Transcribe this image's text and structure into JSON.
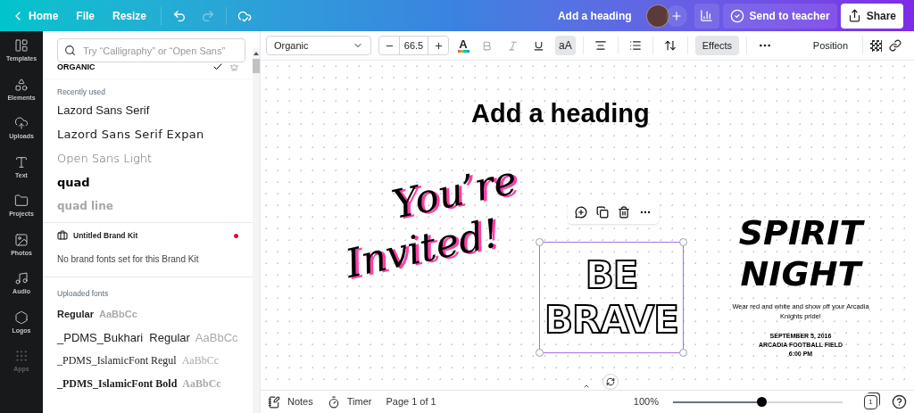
{
  "topbar": {
    "nav": [
      "Home",
      "File",
      "Resize"
    ],
    "title": "Add a heading",
    "send": "Send to teacher",
    "share": "Share"
  },
  "rail": [
    {
      "label": "Templates",
      "selected": false
    },
    {
      "label": "Elements",
      "selected": false
    },
    {
      "label": "Uploads",
      "selected": false
    },
    {
      "label": "Text",
      "selected": false
    },
    {
      "label": "Projects",
      "selected": false
    },
    {
      "label": "Photos",
      "selected": false
    },
    {
      "label": "Audio",
      "selected": false
    },
    {
      "label": "Logos",
      "selected": false
    },
    {
      "label": "Apps",
      "selected": false
    }
  ],
  "font_panel": {
    "placeholder": "Try “Calligraphy” or “Open Sans”",
    "current": {
      "name": "ORGANIC",
      "checked": true
    },
    "recent": {
      "heading": "Recently used",
      "fonts": [
        "Lazord Sans Serif",
        "Lazord Sans Serif Expan",
        "Open Sans Light",
        "quad",
        "quad line"
      ]
    },
    "brand_kit": {
      "title": "Untitled Brand Kit",
      "note": "No brand fonts set for this Brand Kit"
    },
    "uploaded": {
      "heading": "Uploaded fonts",
      "fonts": [
        {
          "name": "Regular",
          "sample": "AaBbCc"
        },
        {
          "name": "_PDMS_Bukhari  Regular",
          "sample": "AaBbCc"
        },
        {
          "name": "_PDMS_IslamicFont Regul",
          "sample": "AaBbCc"
        },
        {
          "name": "_PDMS_IslamicFont Bold",
          "sample": "AaBbCc"
        }
      ]
    }
  },
  "toolbar": {
    "font": "Organic",
    "size": "66.5",
    "color_glyph": "A",
    "case_label": "aA",
    "case_selected": true,
    "effects": {
      "label": "Effects",
      "selected": true
    },
    "position": "Position"
  },
  "canvas": {
    "heading": "Add a heading",
    "invited": [
      "You’re",
      "Invited!"
    ],
    "brave": [
      "BE",
      "BRAVE"
    ],
    "spirit": {
      "title": [
        "SPIRIT",
        "NIGHT"
      ],
      "description": "Wear red and white and show off your Arcadia Knights pride!",
      "details": [
        "SEPTEMBER 5, 2016",
        "ARCADIA FOOTBALL FIELD",
        "6:00 PM"
      ]
    }
  },
  "bottom": {
    "notes": "Notes",
    "timer": "Timer",
    "page": "Page 1 of 1",
    "zoom": "100%",
    "zoom_slider": {
      "level": 0.52
    },
    "pages": "1"
  }
}
